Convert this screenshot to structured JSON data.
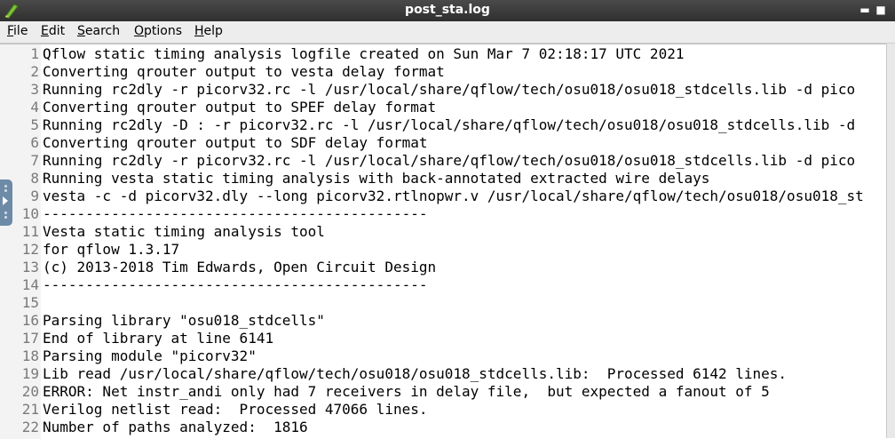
{
  "window": {
    "title": "post_sta.log"
  },
  "menu": [
    {
      "pre": "",
      "ul": "F",
      "post": "ile"
    },
    {
      "pre": "",
      "ul": "E",
      "post": "dit"
    },
    {
      "pre": "",
      "ul": "S",
      "post": "earch"
    },
    {
      "pre": "",
      "ul": "O",
      "post": "ptions"
    },
    {
      "pre": "",
      "ul": "H",
      "post": "elp"
    }
  ],
  "lines": [
    {
      "n": "1",
      "text": "Qflow static timing analysis logfile created on Sun Mar 7 02:18:17 UTC 2021"
    },
    {
      "n": "2",
      "text": "Converting qrouter output to vesta delay format"
    },
    {
      "n": "3",
      "text": "Running rc2dly -r picorv32.rc -l /usr/local/share/qflow/tech/osu018/osu018_stdcells.lib -d pico"
    },
    {
      "n": "4",
      "text": "Converting qrouter output to SPEF delay format"
    },
    {
      "n": "5",
      "text": "Running rc2dly -D : -r picorv32.rc -l /usr/local/share/qflow/tech/osu018/osu018_stdcells.lib -d"
    },
    {
      "n": "6",
      "text": "Converting qrouter output to SDF delay format"
    },
    {
      "n": "7",
      "text": "Running rc2dly -r picorv32.rc -l /usr/local/share/qflow/tech/osu018/osu018_stdcells.lib -d pico"
    },
    {
      "n": "8",
      "text": "Running vesta static timing analysis with back-annotated extracted wire delays"
    },
    {
      "n": "9",
      "text": "vesta -c -d picorv32.dly --long picorv32.rtlnopwr.v /usr/local/share/qflow/tech/osu018/osu018_st"
    },
    {
      "n": "10",
      "text": "---------------------------------------------"
    },
    {
      "n": "11",
      "text": "Vesta static timing analysis tool"
    },
    {
      "n": "12",
      "text": "for qflow 1.3.17"
    },
    {
      "n": "13",
      "text": "(c) 2013-2018 Tim Edwards, Open Circuit Design"
    },
    {
      "n": "14",
      "text": "---------------------------------------------"
    },
    {
      "n": "15",
      "text": ""
    },
    {
      "n": "16",
      "text": "Parsing library \"osu018_stdcells\""
    },
    {
      "n": "17",
      "text": "End of library at line 6141"
    },
    {
      "n": "18",
      "text": "Parsing module \"picorv32\""
    },
    {
      "n": "19",
      "text": "Lib read /usr/local/share/qflow/tech/osu018/osu018_stdcells.lib:  Processed 6142 lines."
    },
    {
      "n": "20",
      "text": "ERROR: Net instr_andi only had 7 receivers in delay file,  but expected a fanout of 5"
    },
    {
      "n": "21",
      "text": "Verilog netlist read:  Processed 47066 lines."
    },
    {
      "n": "22",
      "text": "Number of paths analyzed:  1816"
    }
  ]
}
